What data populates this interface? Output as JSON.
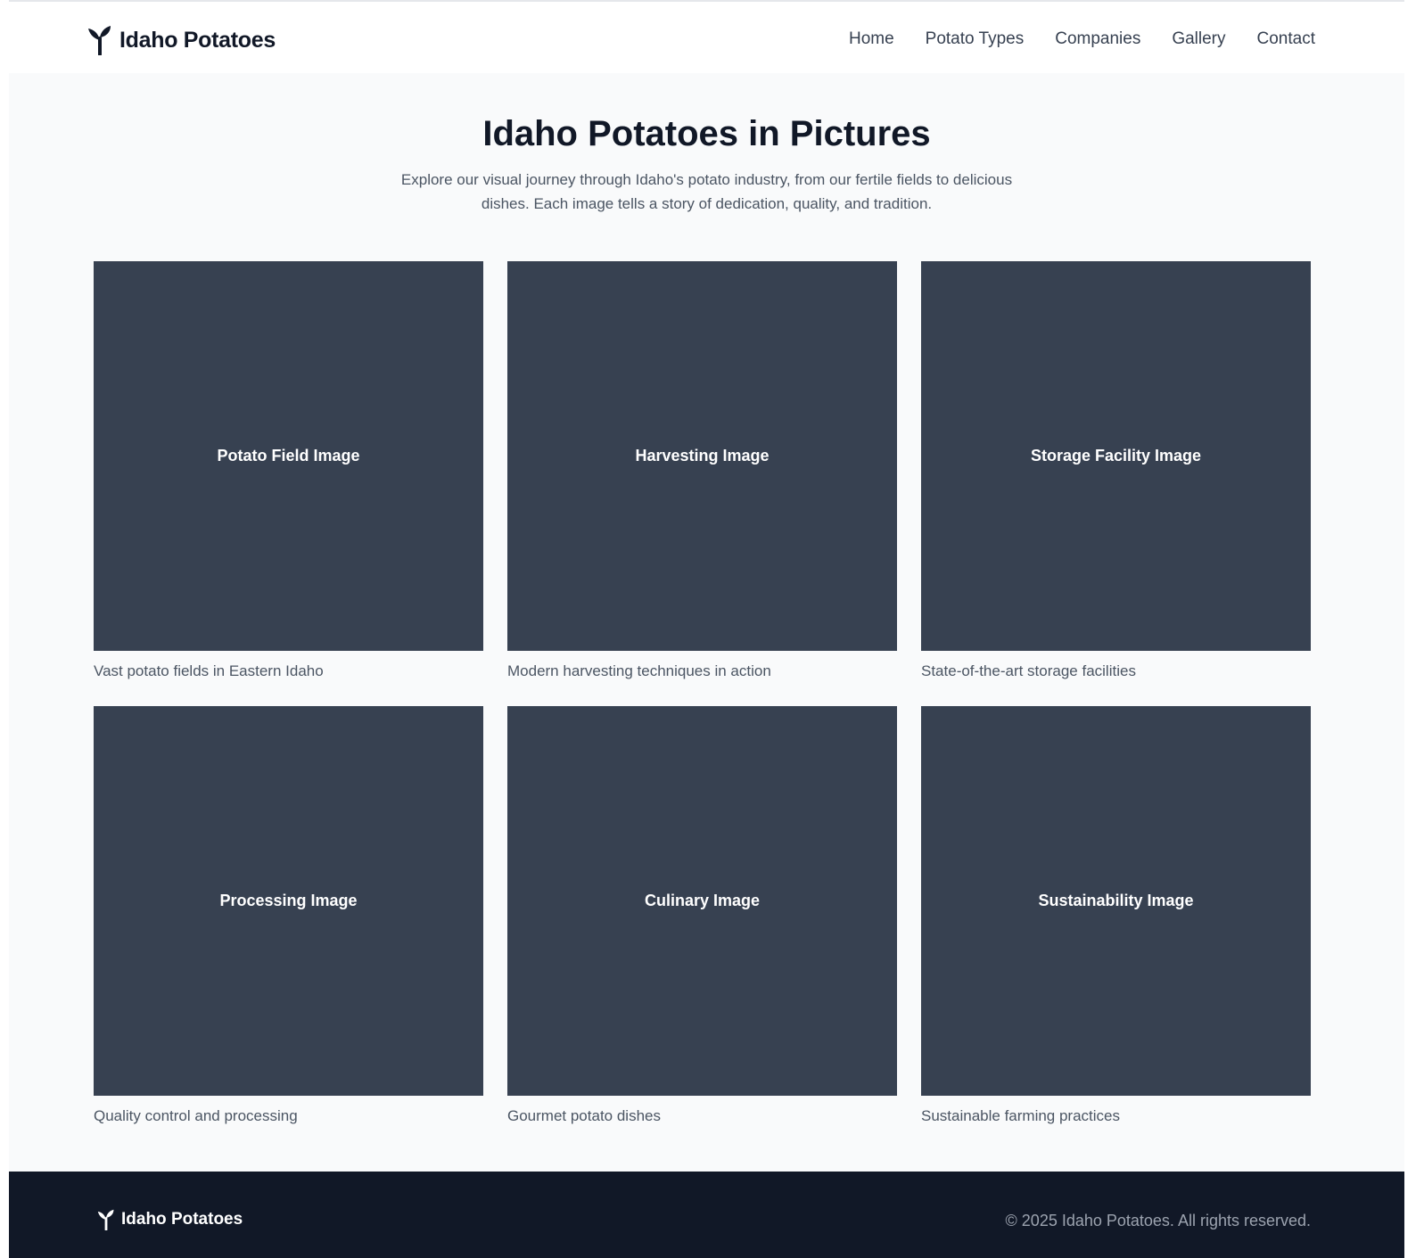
{
  "header": {
    "brand_name": "Idaho Potatoes",
    "brand_icon": "sprout-icon",
    "nav": [
      "Home",
      "Potato Types",
      "Companies",
      "Gallery",
      "Contact"
    ]
  },
  "main": {
    "title": "Idaho Potatoes in Pictures",
    "intro": "Explore our visual journey through Idaho's potato industry, from our fertile fields to delicious dishes. Each image tells a story of dedication, quality, and tradition.",
    "gallery": [
      {
        "image_label": "Potato Field Image",
        "caption": "Vast potato fields in Eastern Idaho"
      },
      {
        "image_label": "Harvesting Image",
        "caption": "Modern harvesting techniques in action"
      },
      {
        "image_label": "Storage Facility Image",
        "caption": "State-of-the-art storage facilities"
      },
      {
        "image_label": "Processing Image",
        "caption": "Quality control and processing"
      },
      {
        "image_label": "Culinary Image",
        "caption": "Gourmet potato dishes"
      },
      {
        "image_label": "Sustainability Image",
        "caption": "Sustainable farming practices"
      }
    ]
  },
  "footer": {
    "brand_name": "Idaho Potatoes",
    "copyright": "© 2025 Idaho Potatoes. All rights reserved."
  },
  "colors": {
    "header_bg": "#ffffff",
    "main_bg": "#f9fafb",
    "image_placeholder": "#374151",
    "footer_bg": "#111827"
  }
}
